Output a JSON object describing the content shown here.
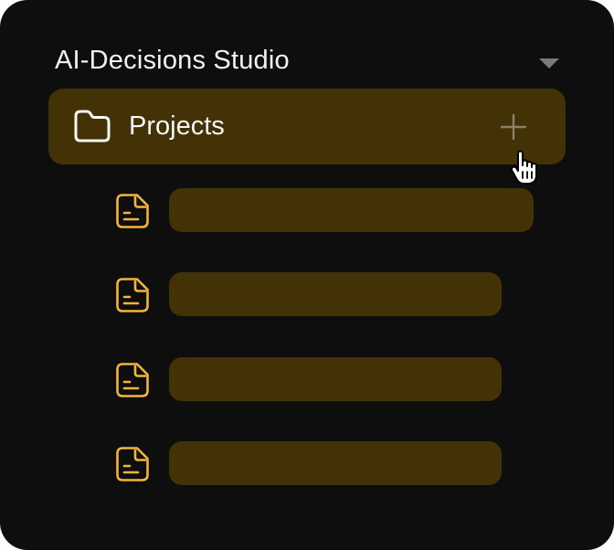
{
  "workspace": {
    "title": "AI-Decisions Studio",
    "dropdown_icon": "caret-down-icon"
  },
  "nav": {
    "projects": {
      "label": "Projects",
      "icon": "folder-icon",
      "add_icon": "plus-icon"
    },
    "documents": [
      {
        "icon": "document-icon"
      },
      {
        "icon": "document-icon"
      },
      {
        "icon": "document-icon"
      },
      {
        "icon": "document-icon"
      }
    ]
  },
  "colors": {
    "background": "#0e0e0e",
    "highlight": "#433206",
    "accent": "#f2b53a",
    "text": "#f2f2f2",
    "muted": "#7a7a7a"
  }
}
